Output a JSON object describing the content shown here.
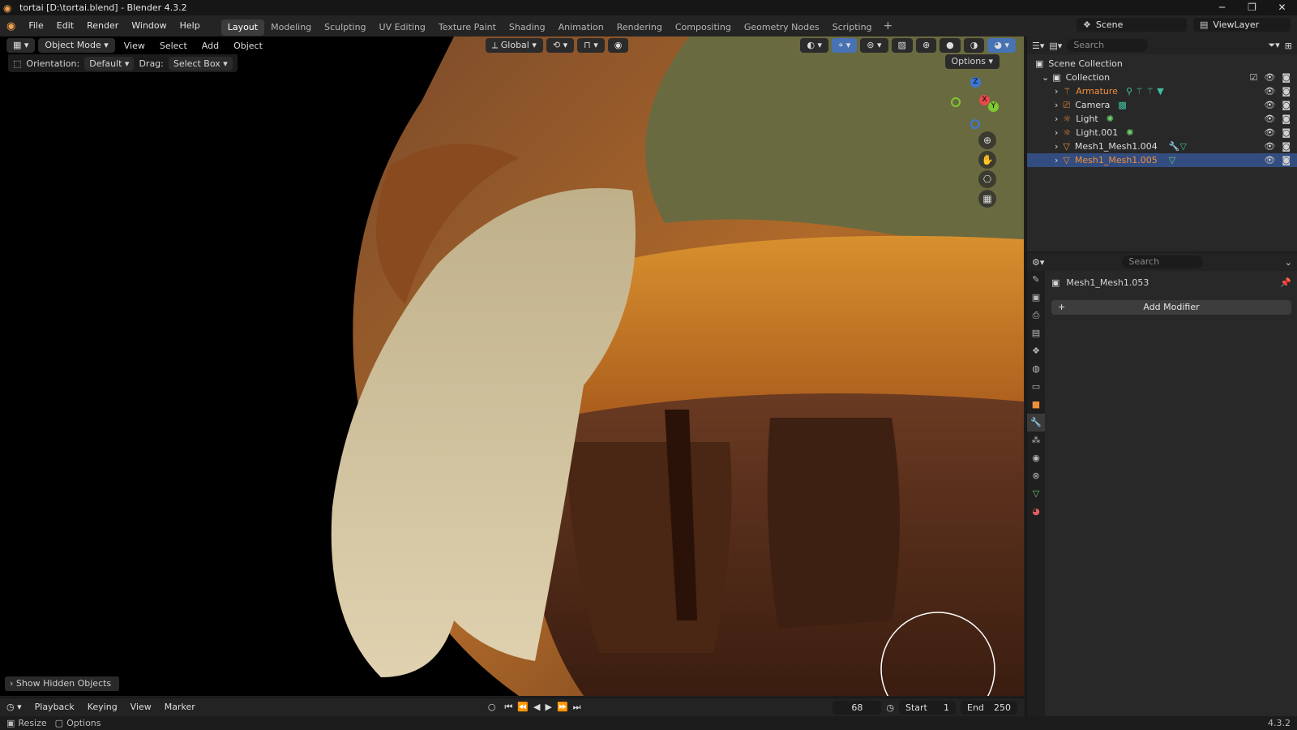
{
  "titlebar": {
    "title": "tortai [D:\\tortai.blend] - Blender 4.3.2",
    "min": "─",
    "max": "❐",
    "close": "✕"
  },
  "menu": [
    "File",
    "Edit",
    "Render",
    "Window",
    "Help"
  ],
  "workspaces": [
    "Layout",
    "Modeling",
    "Sculpting",
    "UV Editing",
    "Texture Paint",
    "Shading",
    "Animation",
    "Rendering",
    "Compositing",
    "Geometry Nodes",
    "Scripting"
  ],
  "scene": {
    "label": "Scene",
    "viewlayer": "ViewLayer"
  },
  "viewport_header": {
    "mode": "Object Mode",
    "view": "View",
    "select": "Select",
    "add": "Add",
    "object": "Object",
    "transform": "Global"
  },
  "tool_settings": {
    "orientation_label": "Orientation:",
    "orientation_value": "Default",
    "drag_label": "Drag:",
    "drag_value": "Select Box"
  },
  "options_label": "Options",
  "gizmo": {
    "z": "Z",
    "x": "X",
    "y": "Y"
  },
  "show_hidden": "Show Hidden Objects",
  "timeline": {
    "playback": "Playback",
    "keying": "Keying",
    "view": "View",
    "marker": "Marker",
    "frame": "68",
    "start_label": "Start",
    "start": "1",
    "end_label": "End",
    "end": "250"
  },
  "statusbar": {
    "resize": "Resize",
    "options": "Options",
    "version": "4.3.2"
  },
  "outliner": {
    "search_placeholder": "Search",
    "scene_collection": "Scene Collection",
    "collection": "Collection",
    "items": [
      {
        "name": "Armature",
        "icon": "armature-icon",
        "selected": true
      },
      {
        "name": "Camera",
        "icon": "camera-icon",
        "selected": false
      },
      {
        "name": "Light",
        "icon": "light-icon",
        "selected": false
      },
      {
        "name": "Light.001",
        "icon": "light-icon",
        "selected": false
      },
      {
        "name": "Mesh1_Mesh1.004",
        "icon": "mesh-icon",
        "selected": false
      },
      {
        "name": "Mesh1_Mesh1.005",
        "icon": "mesh-icon",
        "selected": true
      }
    ]
  },
  "properties": {
    "search_placeholder": "Search",
    "object_name": "Mesh1_Mesh1.053",
    "add_modifier": "Add Modifier"
  },
  "colors": {
    "accent": "#f0903a",
    "selected_blue": "#4772b3",
    "bg": "#282828"
  }
}
